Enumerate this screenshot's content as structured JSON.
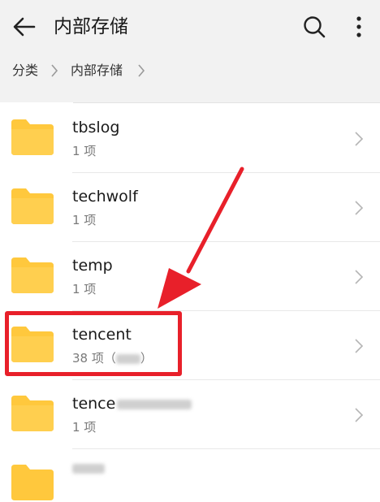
{
  "header": {
    "title": "内部存储",
    "back_icon": "arrow-left-icon",
    "search_icon": "search-icon",
    "more_icon": "more-vertical-icon"
  },
  "breadcrumb": {
    "items": [
      "分类",
      "内部存储"
    ]
  },
  "folders": [
    {
      "name": "tbslog",
      "meta": "1 项"
    },
    {
      "name": "techwolf",
      "meta": "1 项"
    },
    {
      "name": "temp",
      "meta": "1 项"
    },
    {
      "name": "tencent",
      "meta": "38 项（",
      "meta_suffix": "）"
    },
    {
      "name": "tence",
      "meta": "1 项"
    }
  ],
  "colors": {
    "folder": "#ffc83d",
    "annotation": "#e8202a",
    "header_bg": "#f2f2f2"
  }
}
